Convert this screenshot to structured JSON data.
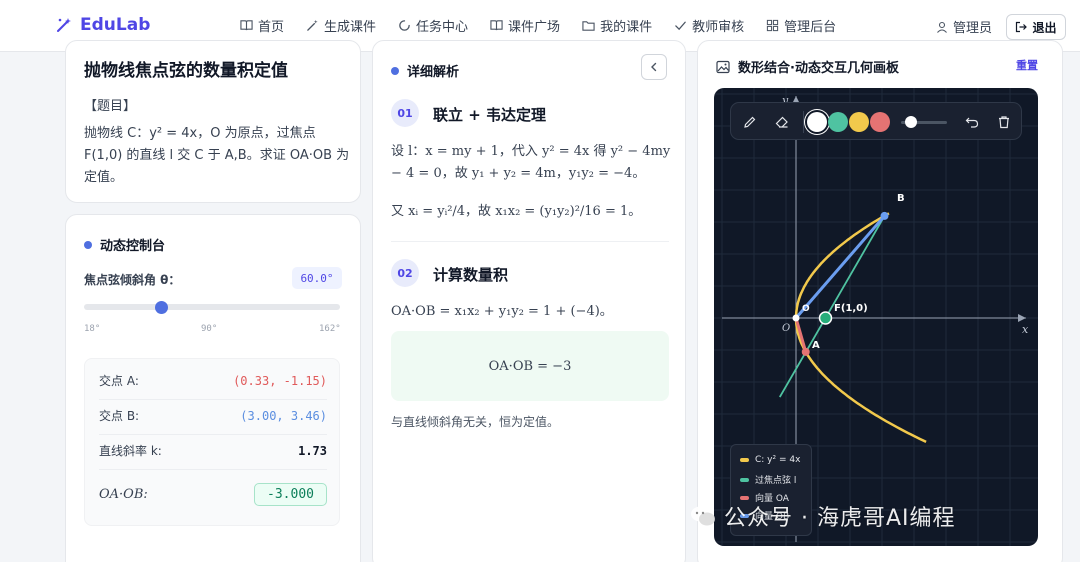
{
  "app": {
    "logo": "EduLab"
  },
  "nav": [
    {
      "label": "首页",
      "icon": "book-icon"
    },
    {
      "label": "生成课件",
      "icon": "magic-wand-icon"
    },
    {
      "label": "任务中心",
      "icon": "spinner-icon"
    },
    {
      "label": "课件广场",
      "icon": "book-icon"
    },
    {
      "label": "我的课件",
      "icon": "folder-icon"
    },
    {
      "label": "教师审核",
      "icon": "check-icon"
    },
    {
      "label": "管理后台",
      "icon": "grid-icon"
    }
  ],
  "user": {
    "name": "管理员",
    "logout": "退出"
  },
  "problem": {
    "title": "抛物线焦点弦的数量积定值",
    "tag": "【题目】",
    "body": "抛物线 C：y² = 4x，O 为原点，过焦点 F(1,0) 的直线 l 交 C 于 A,B。求证 OA·OB 为定值。"
  },
  "control": {
    "heading": "动态控制台",
    "slider_label": "焦点弦倾斜角 θ：",
    "slider_value": "60.0°",
    "slider_fraction": 0.3,
    "ticks": [
      "18°",
      "90°",
      "162°"
    ],
    "rows": [
      {
        "label": "交点 A:",
        "value": "(0.33, -1.15)",
        "color": "#e05a5a"
      },
      {
        "label": "交点 B:",
        "value": "(3.00, 3.46)",
        "color": "#5b8ee0"
      },
      {
        "label": "直线斜率 k:",
        "value": "1.73",
        "color": "#111827"
      }
    ],
    "dot_label": "OA·OB:",
    "dot_value": "-3.000"
  },
  "analysis": {
    "heading": "详细解析",
    "step1": {
      "no": "01",
      "title": "联立 + 韦达定理",
      "line1": "设 l：x = my + 1，代入 y² = 4x 得 y² − 4my − 4 = 0，故 y₁ + y₂ = 4m，y₁y₂ = −4。",
      "line2": "又 xᵢ = yᵢ²/4，故 x₁x₂ = (y₁y₂)²/16 = 1。"
    },
    "step2": {
      "no": "02",
      "title": "计算数量积",
      "line1": "OA·OB = x₁x₂ + y₁y₂ = 1 + (−4)。",
      "result": "OA·OB = −3",
      "note": "与直线倾斜角无关，恒为定值。"
    }
  },
  "board": {
    "title": "数形结合·动态交互几何画板",
    "reset": "重置",
    "labels": {
      "x": "x",
      "y": "y",
      "origin": "O",
      "origin_top": "O",
      "focus": "F(1,0)",
      "a": "A",
      "b": "B"
    },
    "colors": {
      "curve": "#f2c94c",
      "line": "#4fc3a1",
      "oa": "#e57373",
      "ob": "#6b9ef0",
      "bg": "#101827"
    },
    "palette": [
      "#ffffff",
      "#4fc3a1",
      "#f2c94c",
      "#e57373"
    ],
    "legend": [
      {
        "label": "C: y² = 4x",
        "color": "#f2c94c"
      },
      {
        "label": "过焦点弦 l",
        "color": "#4fc3a1"
      },
      {
        "label": "向量 OA",
        "color": "#e57373"
      },
      {
        "label": "向量 OB",
        "color": "#6b9ef0"
      }
    ]
  },
  "watermark": "公众号 · 海虎哥AI编程"
}
